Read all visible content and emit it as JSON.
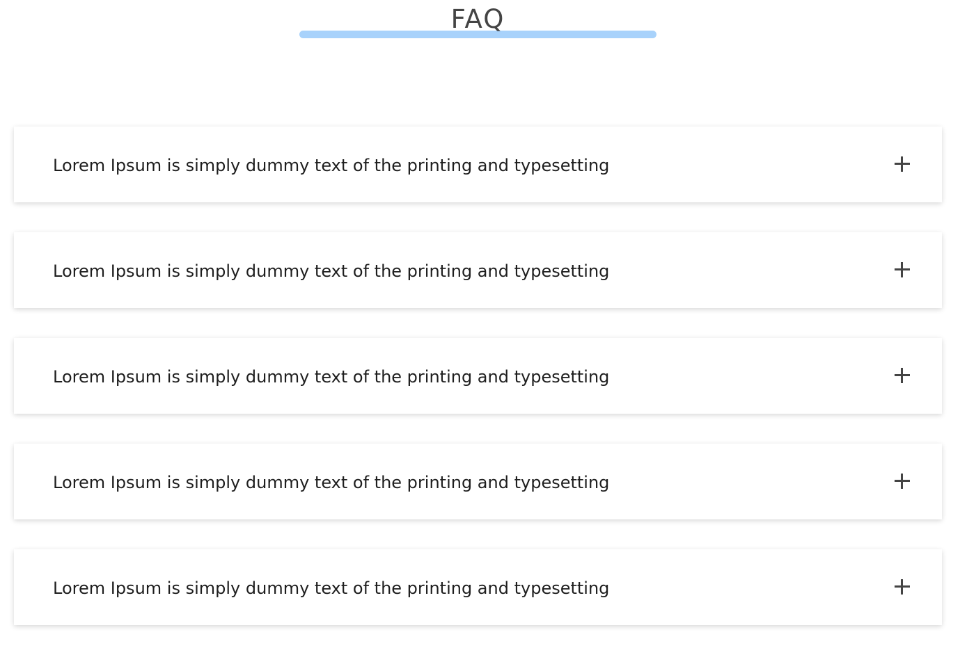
{
  "header": {
    "title": "FAQ",
    "underline_color": "#a8d2fb"
  },
  "faq": {
    "items": [
      {
        "question": "Lorem Ipsum is simply dummy text of the printing and typesetting",
        "icon": "plus-icon",
        "expanded": false
      },
      {
        "question": "Lorem Ipsum is simply dummy text of the printing and typesetting",
        "icon": "plus-icon",
        "expanded": false
      },
      {
        "question": "Lorem Ipsum is simply dummy text of the printing and typesetting",
        "icon": "plus-icon",
        "expanded": false
      },
      {
        "question": "Lorem Ipsum is simply dummy text of the printing and typesetting",
        "icon": "plus-icon",
        "expanded": false
      },
      {
        "question": "Lorem Ipsum is simply dummy text of the printing and typesetting",
        "icon": "plus-icon",
        "expanded": false
      }
    ]
  }
}
